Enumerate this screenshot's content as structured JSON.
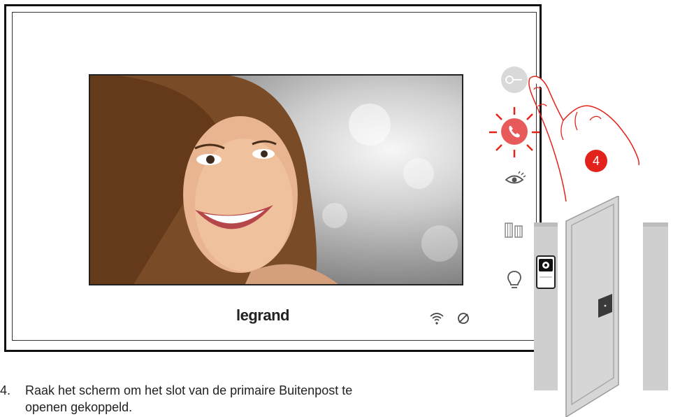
{
  "brand": {
    "logo_text": "legrand"
  },
  "step": {
    "number": "4"
  },
  "instruction": {
    "number": "4.",
    "line1": "Raak het scherm om het slot van de primaire Buitenpost te",
    "line2": "openen gekoppeld."
  },
  "buttons": [
    {
      "icon": "key-icon",
      "state": "touched"
    },
    {
      "icon": "call-handset-icon",
      "state": "flashing",
      "color": "#e85a5a"
    },
    {
      "icon": "eye-icon",
      "state": "idle"
    },
    {
      "icon": "gate-icon",
      "state": "idle"
    },
    {
      "icon": "light-bulb-icon",
      "state": "idle"
    }
  ],
  "status_icons": [
    "wifi-icon",
    "do-not-disturb-icon"
  ],
  "colors": {
    "accent_red": "#e3231b",
    "button_grey": "#d9d9d9"
  }
}
